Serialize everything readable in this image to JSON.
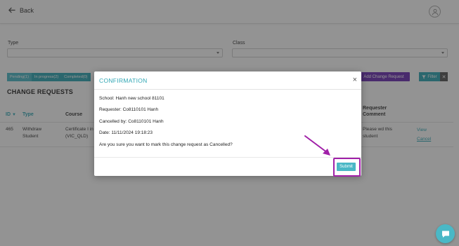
{
  "header": {
    "back_label": "Back"
  },
  "filters": {
    "type_label": "Type",
    "class_label": "Class"
  },
  "tabs": [
    {
      "label": "Pending(1)"
    },
    {
      "label": "In progress(2)"
    },
    {
      "label": "Completed(0)"
    }
  ],
  "actions": {
    "add_label": "Add Change Request",
    "filter_label": "Filter",
    "clear_label": "✕"
  },
  "section_title": "CHANGE REQUESTS",
  "table": {
    "headers": {
      "id": "ID",
      "type": "Type",
      "course": "Course",
      "comment_1": "Requester",
      "comment_2": "Comment"
    },
    "row": {
      "id": "465",
      "type_1": "Withdraw",
      "type_2": "Student",
      "course_1": "Certificate I in",
      "course_2": "(VIC_QLD)",
      "comment_1": "Please wd this",
      "comment_2": "student",
      "view_label": "View",
      "cancel_label": "Cancel"
    }
  },
  "modal": {
    "title": "CONFIRMATION",
    "close": "×",
    "school": "School: Hanh new school 81101",
    "requester": "Requester: Co8110101 Hanh",
    "cancelled_by": "Cancelled by: Co8110101 Hanh",
    "date": "Date: 11/11/2024 19:18:23",
    "question": "Are you sure you want to mark this change request as Cancelled?",
    "submit_label": "Submit"
  },
  "colors": {
    "accent": "#2fa6b4",
    "purple": "#6b2fb3",
    "highlight": "#a020a8"
  },
  "icons": {
    "back": "arrow-left-icon",
    "user": "user-icon",
    "filter": "filter-icon",
    "chat": "chat-icon"
  }
}
